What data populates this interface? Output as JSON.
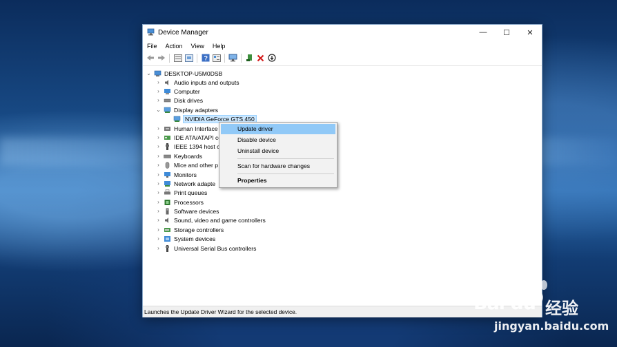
{
  "window": {
    "title": "Device Manager",
    "controls": {
      "minimize": "—",
      "maximize": "☐",
      "close": "✕"
    }
  },
  "menu": [
    "File",
    "Action",
    "View",
    "Help"
  ],
  "toolbar_icons": [
    "back-arrow-icon",
    "forward-arrow-icon",
    "properties-grid-icon",
    "computer-list-icon",
    "help-icon",
    "device-view-icon",
    "monitor-scan-icon",
    "enable-device-icon",
    "uninstall-x-icon",
    "update-driver-icon"
  ],
  "tree": {
    "root": "DESKTOP-U5M0DSB",
    "items": [
      {
        "label": "Audio inputs and outputs",
        "icon": "speaker-icon"
      },
      {
        "label": "Computer",
        "icon": "computer-icon"
      },
      {
        "label": "Disk drives",
        "icon": "disk-icon"
      },
      {
        "label": "Display adapters",
        "icon": "display-adapter-icon",
        "expanded": true
      },
      {
        "label": "Human Interface",
        "icon": "hid-icon"
      },
      {
        "label": "IDE ATA/ATAPI co",
        "icon": "ide-icon"
      },
      {
        "label": "IEEE 1394 host co",
        "icon": "ieee1394-icon"
      },
      {
        "label": "Keyboards",
        "icon": "keyboard-icon"
      },
      {
        "label": "Mice and other p",
        "icon": "mouse-icon"
      },
      {
        "label": "Monitors",
        "icon": "monitor-icon"
      },
      {
        "label": "Network adapte",
        "icon": "network-icon"
      },
      {
        "label": "Print queues",
        "icon": "printer-icon"
      },
      {
        "label": "Processors",
        "icon": "processor-icon"
      },
      {
        "label": "Software devices",
        "icon": "software-device-icon"
      },
      {
        "label": "Sound, video and game controllers",
        "icon": "sound-icon"
      },
      {
        "label": "Storage controllers",
        "icon": "storage-icon"
      },
      {
        "label": "System devices",
        "icon": "system-device-icon"
      },
      {
        "label": "Universal Serial Bus controllers",
        "icon": "usb-icon"
      }
    ],
    "selected_child": "NVIDIA GeForce GTS 450"
  },
  "context_menu": {
    "update": "Update driver",
    "disable": "Disable device",
    "uninstall": "Uninstall device",
    "scan": "Scan for hardware changes",
    "properties": "Properties"
  },
  "status": "Launches the Update Driver Wizard for the selected device.",
  "watermark": {
    "logo": "Bai du",
    "cn": "经验",
    "url": "jingyan.baidu.com"
  },
  "colors": {
    "selection": "#cce8ff",
    "menu_highlight": "#91c9f7",
    "desktop": "#1a4f8c"
  }
}
